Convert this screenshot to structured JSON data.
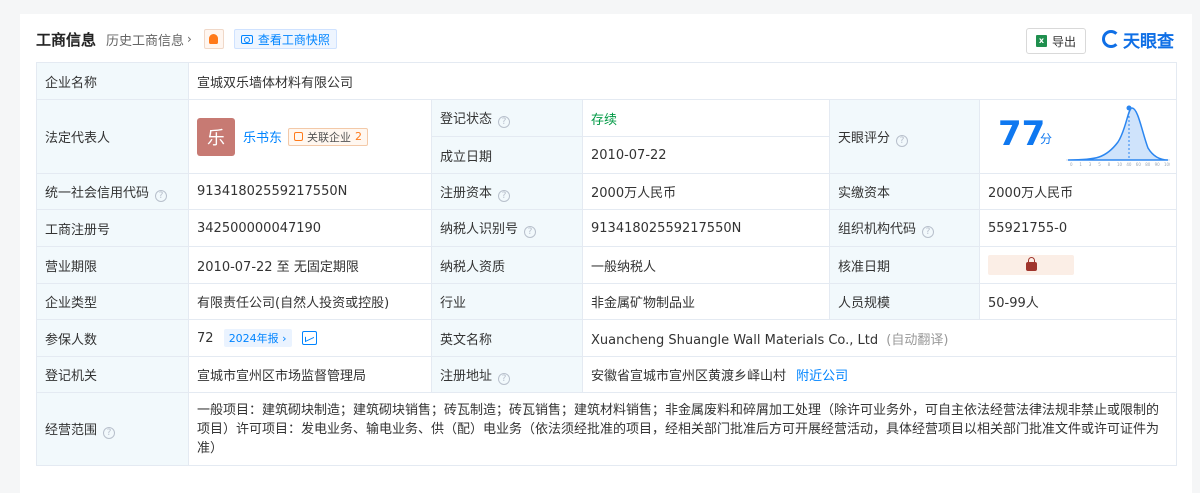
{
  "header": {
    "title": "工商信息",
    "history": "历史工商信息",
    "snapshot": "查看工商快照",
    "export": "导出",
    "brand": "天眼查"
  },
  "rows": {
    "company_name_label": "企业名称",
    "company_name": "宣城双乐墙体材料有限公司",
    "legal_rep_label": "法定代表人",
    "legal_rep_avatar": "乐",
    "legal_rep_name": "乐书东",
    "related_label": "关联企业",
    "related_count": "2",
    "reg_status_label": "登记状态",
    "reg_status": "存续",
    "established_label": "成立日期",
    "established": "2010-07-22",
    "score_label": "天眼评分",
    "score": "77",
    "score_unit": "分",
    "credit_code_label": "统一社会信用代码",
    "credit_code": "91341802559217550N",
    "reg_capital_label": "注册资本",
    "reg_capital": "2000万人民币",
    "paid_capital_label": "实缴资本",
    "paid_capital": "2000万人民币",
    "reg_no_label": "工商注册号",
    "reg_no": "342500000047190",
    "taxpayer_id_label": "纳税人识别号",
    "taxpayer_id": "91341802559217550N",
    "org_code_label": "组织机构代码",
    "org_code": "55921755-0",
    "term_label": "营业期限",
    "term": "2010-07-22 至 无固定期限",
    "taxpayer_qual_label": "纳税人资质",
    "taxpayer_qual": "一般纳税人",
    "approve_date_label": "核准日期",
    "type_label": "企业类型",
    "type": "有限责任公司(自然人投资或控股)",
    "industry_label": "行业",
    "industry": "非金属矿物制品业",
    "staff_label": "人员规模",
    "staff": "50-99人",
    "insured_label": "参保人数",
    "insured": "72",
    "insured_report": "2024年报",
    "english_label": "英文名称",
    "english": "Xuancheng Shuangle Wall Materials Co., Ltd",
    "english_auto": "(自动翻译)",
    "authority_label": "登记机关",
    "authority": "宣城市宣州区市场监督管理局",
    "address_label": "注册地址",
    "address": "安徽省宣城市宣州区黄渡乡峄山村",
    "nearby": "附近公司",
    "scope_label": "经营范围",
    "scope": "一般项目：建筑砌块制造；建筑砌块销售；砖瓦制造；砖瓦销售；建筑材料销售；非金属废料和碎屑加工处理（除许可业务外，可自主依法经营法律法规非禁止或限制的项目）许可项目：发电业务、输电业务、供（配）电业务（依法须经批准的项目，经相关部门批准后方可开展经营活动，具体经营项目以相关部门批准文件或许可证件为准）"
  },
  "score_axis": [
    "0",
    "1",
    "3",
    "5",
    "8",
    "10",
    "40",
    "60",
    "80",
    "90",
    "100"
  ],
  "colors": {
    "accent": "#0084ff",
    "label_bg": "#f2f9fc",
    "status_green": "#009944",
    "score_blue": "#0f78f0"
  }
}
